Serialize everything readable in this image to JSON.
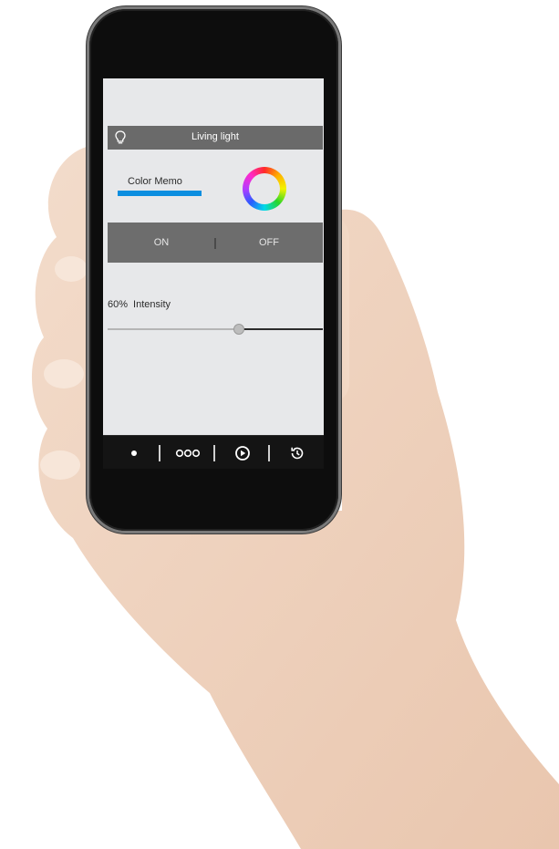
{
  "device_screen": {
    "header": {
      "title": "Living light",
      "icon": "bulb-icon"
    },
    "color_memo": {
      "label": "Color Memo",
      "bar_color": "#0b8ee0",
      "wheel_icon": "color-wheel-icon"
    },
    "power": {
      "on_label": "ON",
      "off_label": "OFF"
    },
    "intensity": {
      "percent_label": "60%",
      "label": "Intensity",
      "value": 0.6
    },
    "tabs": [
      {
        "icon": "dot-icon"
      },
      {
        "icon": "three-circles-icon"
      },
      {
        "icon": "play-circle-icon"
      },
      {
        "icon": "history-icon"
      }
    ]
  }
}
